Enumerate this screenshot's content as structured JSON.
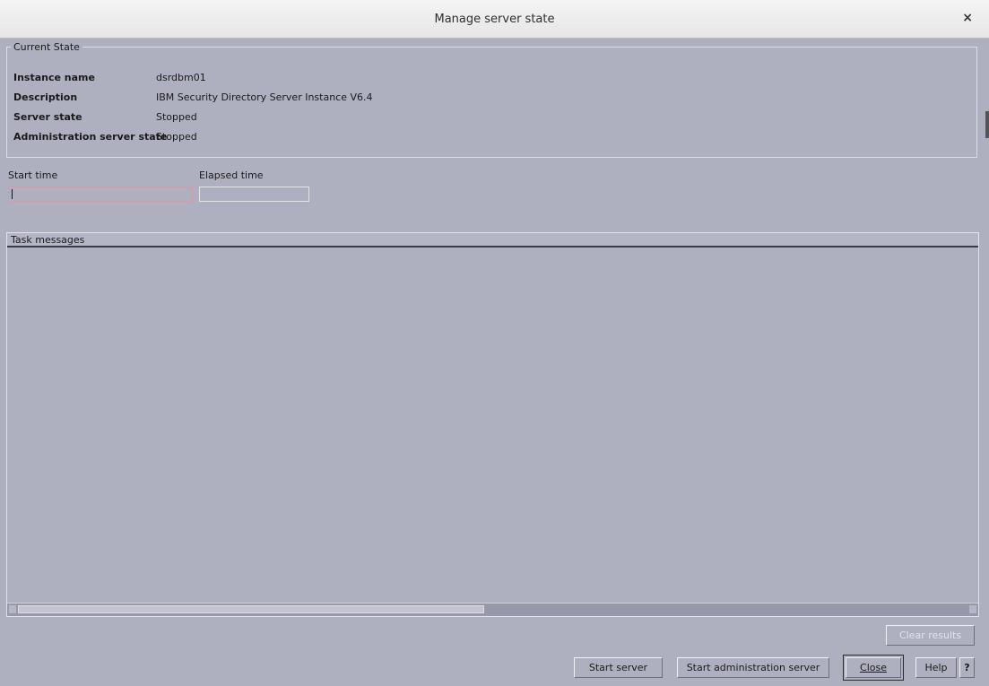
{
  "window": {
    "title": "Manage server state",
    "close_symbol": "×"
  },
  "current_state": {
    "legend": "Current State",
    "rows": [
      {
        "label": "Instance name",
        "value": "dsrdbm01"
      },
      {
        "label": "Description",
        "value": "IBM Security Directory Server Instance V6.4"
      },
      {
        "label": "Server state",
        "value": "Stopped"
      },
      {
        "label": "Administration server state",
        "value": "Stopped"
      }
    ]
  },
  "timing": {
    "start_time_label": "Start time",
    "start_time_value": "",
    "elapsed_time_label": "Elapsed time",
    "elapsed_time_value": ""
  },
  "messages": {
    "header": "Task messages"
  },
  "buttons": {
    "clear_results": "Clear results",
    "start_server": "Start server",
    "start_admin_server": "Start administration server",
    "close": "Close",
    "help": "Help",
    "help_icon": "?"
  },
  "colors": {
    "background": "#aeb0c0",
    "titlebar": "#ececec"
  }
}
